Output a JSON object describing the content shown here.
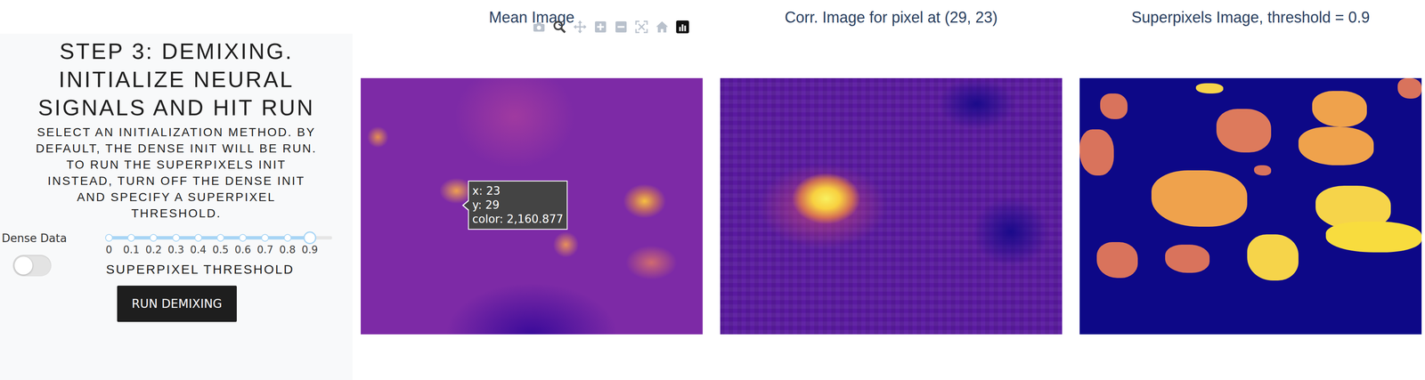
{
  "step": {
    "title_lines": [
      "STEP 3: DEMIXING.",
      "INITIALIZE NEURAL",
      "SIGNALS AND HIT RUN"
    ],
    "description_lines": [
      "SELECT AN INITIALIZATION METHOD. BY",
      "DEFAULT, THE DENSE INIT WILL BE RUN.",
      "TO RUN THE SUPERPIXELS INIT",
      "INSTEAD, TURN OFF THE DENSE INIT",
      "AND SPECIFY A SUPERPIXEL",
      "THRESHOLD."
    ]
  },
  "controls": {
    "dense_toggle": {
      "label": "Dense Data",
      "on": false
    },
    "slider": {
      "ticks": [
        "0",
        "0.1",
        "0.2",
        "0.3",
        "0.4",
        "0.5",
        "0.6",
        "0.7",
        "0.8",
        "0.9"
      ],
      "level": 0.9,
      "label": "SUPERPIXEL THRESHOLD"
    },
    "run_button": "RUN DEMIXING"
  },
  "plots": [
    {
      "title": "Mean Image",
      "kind": "mean"
    },
    {
      "title": "Corr. Image for pixel at (29, 23)",
      "kind": "corr"
    },
    {
      "title": "Superpixels Image, threshold = 0.9",
      "kind": "superpixels"
    }
  ],
  "modebar": [
    {
      "kind": "camera",
      "selected": false
    },
    {
      "kind": "zoom",
      "selected": true
    },
    {
      "kind": "pan",
      "selected": false
    },
    {
      "kind": "zoomin",
      "selected": false
    },
    {
      "kind": "zoomout",
      "selected": false
    },
    {
      "kind": "autoscale",
      "selected": false
    },
    {
      "kind": "home",
      "selected": false
    },
    {
      "kind": "logo",
      "selected": false
    }
  ],
  "tooltip": {
    "lines": [
      "x: 23",
      "y: 29",
      "color: 2,160.877"
    ]
  }
}
